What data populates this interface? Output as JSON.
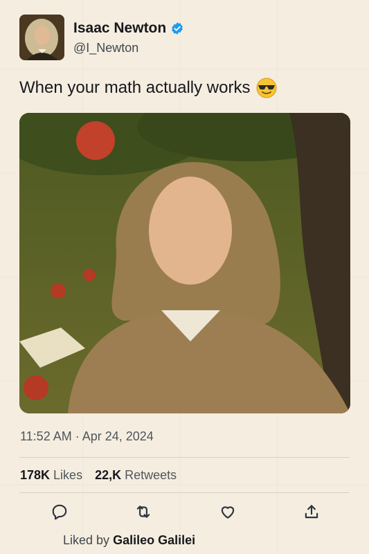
{
  "author": {
    "display_name": "Isaac Newton",
    "handle": "@I_Newton",
    "verified": true,
    "avatar_icon": "portrait-avatar"
  },
  "tweet": {
    "text": "When your math actually works",
    "emoji": "sunglasses-emoji",
    "image": "selfie-under-apple-tree"
  },
  "timestamp": "11:52 AM · Apr 24, 2024",
  "stats": {
    "likes_count": "178K",
    "likes_label": "Likes",
    "retweets_count": "22,K",
    "retweets_label": "Retweets"
  },
  "actions": [
    "reply-icon",
    "retweet-icon",
    "like-icon",
    "share-icon"
  ],
  "liked_by": {
    "prefix": "Liked by",
    "name": "Galileo Galilei"
  },
  "colors": {
    "background": "#f5ede0",
    "verified_blue": "#1d9bf0",
    "text": "#16181c",
    "muted": "#4f565c"
  }
}
